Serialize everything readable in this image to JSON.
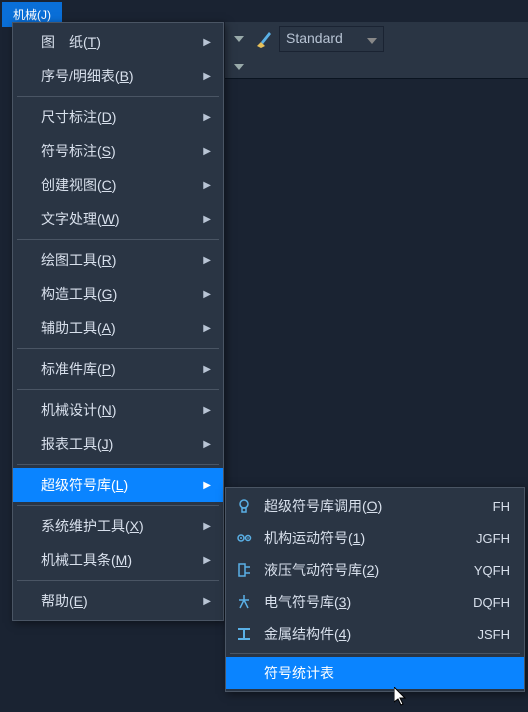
{
  "menuBar": {
    "label": "机械(J)"
  },
  "toolbar": {
    "standard": "Standard"
  },
  "mainMenu": {
    "items": [
      {
        "label": "图　纸(T)",
        "arrow": true
      },
      {
        "label": "序号/明细表(B)",
        "arrow": true
      },
      {
        "label": "尺寸标注(D)",
        "arrow": true
      },
      {
        "label": "符号标注(S)",
        "arrow": true
      },
      {
        "label": "创建视图(C)",
        "arrow": true
      },
      {
        "label": "文字处理(W)",
        "arrow": true
      },
      {
        "label": "绘图工具(R)",
        "arrow": true
      },
      {
        "label": "构造工具(G)",
        "arrow": true
      },
      {
        "label": "辅助工具(A)",
        "arrow": true
      },
      {
        "label": "标准件库(P)",
        "arrow": true
      },
      {
        "label": "机械设计(N)",
        "arrow": true
      },
      {
        "label": "报表工具(J)",
        "arrow": true
      },
      {
        "label": "超级符号库(L)",
        "arrow": true,
        "highlighted": true
      },
      {
        "label": "系统维护工具(X)",
        "arrow": true
      },
      {
        "label": "机械工具条(M)",
        "arrow": true
      },
      {
        "label": "帮助(E)",
        "arrow": true
      }
    ],
    "separatorsAfter": [
      1,
      5,
      8,
      9,
      11,
      12,
      14
    ]
  },
  "subMenu": {
    "items": [
      {
        "icon": "bulb",
        "label": "超级符号库调用(O)",
        "shortcut": "FH"
      },
      {
        "icon": "gears",
        "label": "机构运动符号(1)",
        "shortcut": "JGFH"
      },
      {
        "icon": "hydraulic",
        "label": "液压气动符号库(2)",
        "shortcut": "YQFH"
      },
      {
        "icon": "electric",
        "label": "电气符号库(3)",
        "shortcut": "DQFH"
      },
      {
        "icon": "beam",
        "label": "金属结构件(4)",
        "shortcut": "JSFH"
      },
      {
        "icon": "",
        "label": "符号统计表",
        "shortcut": "",
        "highlighted": true
      }
    ],
    "separatorsAfter": [
      4
    ]
  }
}
